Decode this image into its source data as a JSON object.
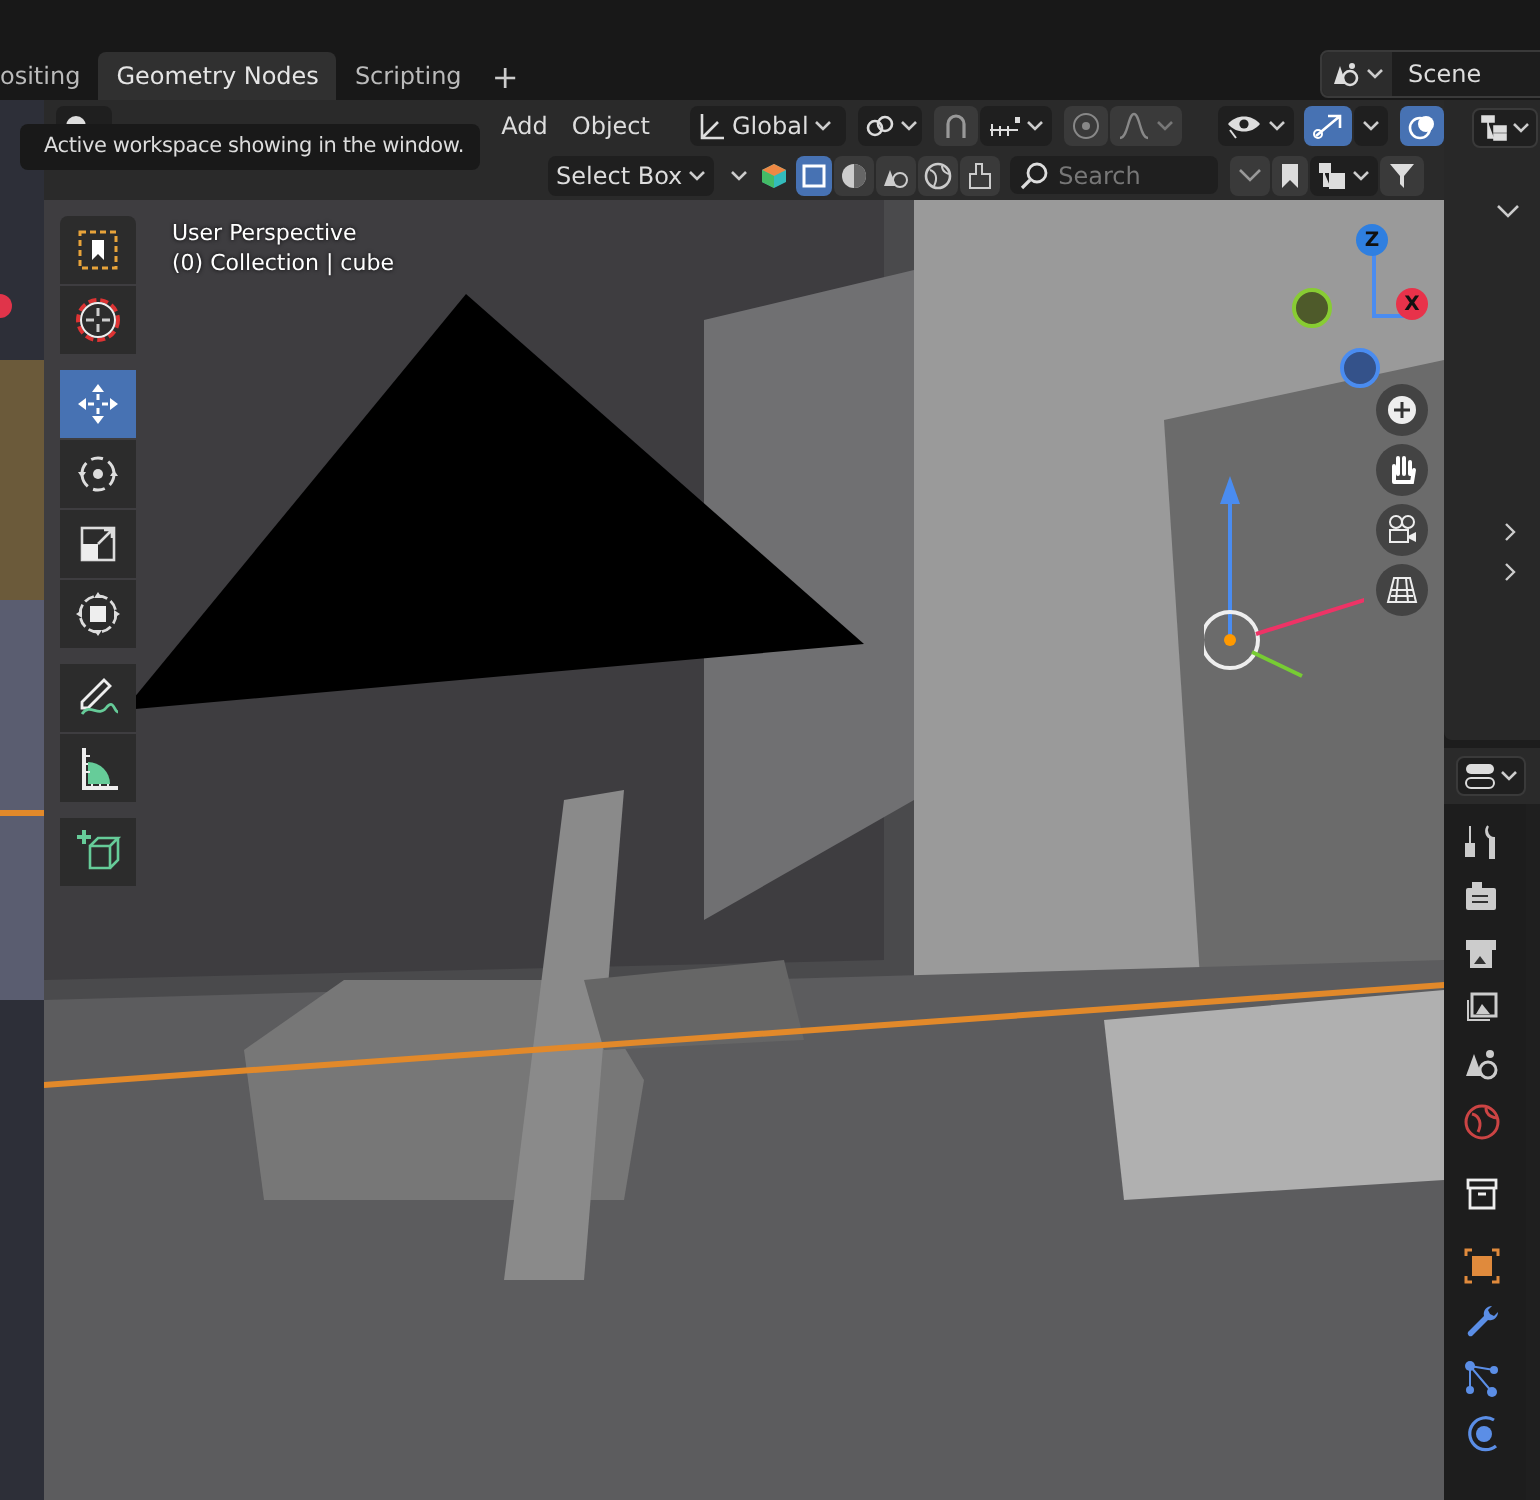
{
  "workspace_tabs": [
    {
      "label": "ositing",
      "selected": false
    },
    {
      "label": "Geometry Nodes",
      "selected": true
    },
    {
      "label": "Scripting",
      "selected": false
    }
  ],
  "add_workspace": "+",
  "scene": {
    "label": "Scene"
  },
  "tooltip": "Active workspace showing in the window.",
  "header_menus": [
    "Add",
    "Object"
  ],
  "transform_orientation": "Global",
  "select_mode": "Select Box",
  "search": {
    "placeholder": "Search"
  },
  "viewport": {
    "kind": "picture",
    "title": "User Perspective",
    "collection": "(0) Collection | cube"
  },
  "tools": [
    {
      "kind": "select",
      "selected": false
    },
    {
      "kind": "cursor",
      "selected": false
    },
    {
      "kind": "move",
      "selected": true
    },
    {
      "kind": "rotate",
      "selected": false
    },
    {
      "kind": "scale",
      "selected": false
    },
    {
      "kind": "transform",
      "selected": false
    },
    {
      "kind": "annotate",
      "selected": false
    },
    {
      "kind": "measure",
      "selected": false
    },
    {
      "kind": "add-cube",
      "selected": false
    }
  ],
  "navigation_gizmo": [
    {
      "label": "Z",
      "color": "#2f7fe0"
    },
    {
      "label": "X",
      "color": "#e8324a"
    }
  ],
  "property_tabs": [
    {
      "kind": "tool"
    },
    {
      "kind": "render"
    },
    {
      "kind": "output"
    },
    {
      "kind": "view-layer"
    },
    {
      "kind": "scene"
    },
    {
      "kind": "world"
    },
    {
      "kind": "collection"
    },
    {
      "kind": "object"
    },
    {
      "kind": "modifier"
    },
    {
      "kind": "particles"
    },
    {
      "kind": "physics"
    }
  ]
}
